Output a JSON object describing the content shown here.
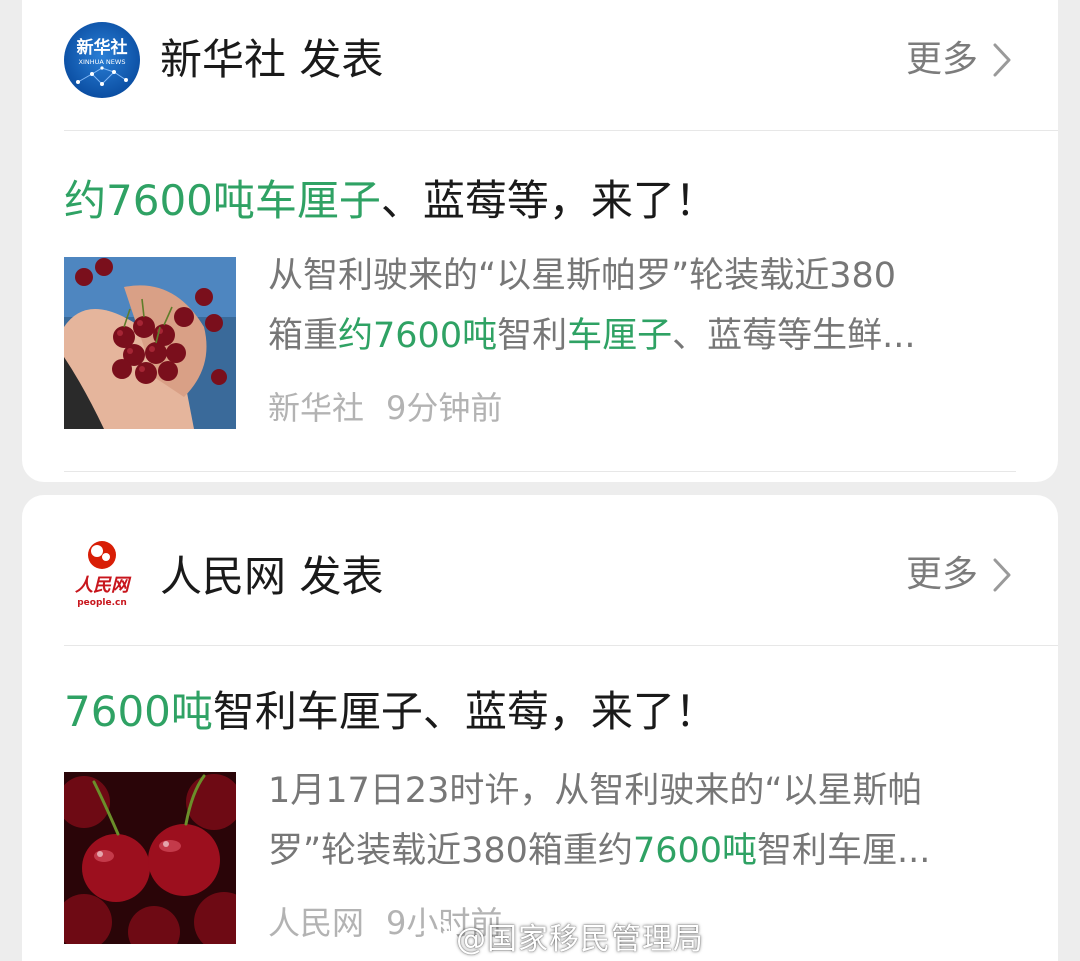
{
  "cards": [
    {
      "publisher": "新华社 发表",
      "logo_icon": "xinhua-news-logo",
      "logo_text": "新华社",
      "logo_subtext": "XINHUA NEWS",
      "more_label": "更多",
      "headline_hl": "约7600吨车厘子",
      "headline_rest": "、蓝莓等，来了！",
      "summary_line1": "从智利驶来的“以星斯帕罗”轮装载近380",
      "summary_line2_a": "箱重",
      "summary_line2_hl1": "约7600吨",
      "summary_line2_b": "智利",
      "summary_line2_hl2": "车厘子",
      "summary_line2_c": "、蓝莓等生鲜...",
      "source": "新华社",
      "time": "9分钟前"
    },
    {
      "publisher": "人民网 发表",
      "logo_icon": "people-daily-logo",
      "logo_text": "人民网",
      "logo_subtext": "people.cn",
      "more_label": "更多",
      "headline_hl": "7600吨",
      "headline_rest": "智利车厘子、蓝莓，来了！",
      "summary_line1": "1月17日23时许，从智利驶来的“以星斯帕",
      "summary_line2_a": "罗”轮装载近380箱重约",
      "summary_line2_hl1": "7600吨",
      "summary_line2_b": "智利车厘...",
      "source": "人民网",
      "time": "9小时前"
    }
  ],
  "watermark": "@国家移民管理局",
  "colors": {
    "highlight": "#2fa264",
    "background": "#ededed",
    "card": "#ffffff"
  }
}
